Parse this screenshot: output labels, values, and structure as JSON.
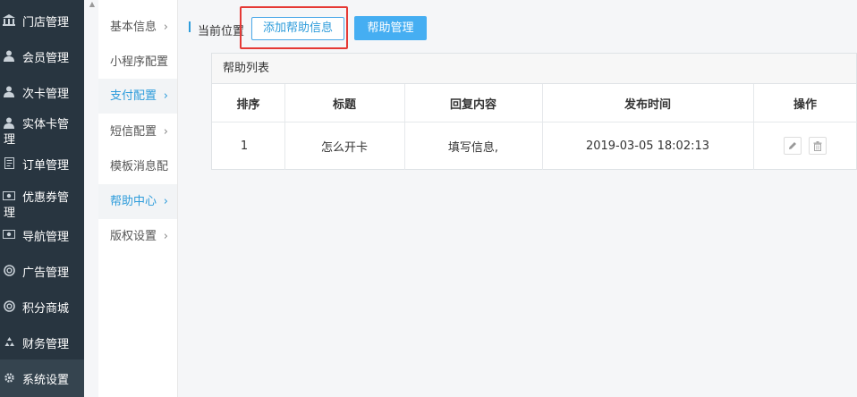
{
  "sidebar": {
    "items": [
      {
        "label": "门店管理",
        "icon": "bank-icon"
      },
      {
        "label": "会员管理",
        "icon": "user-icon"
      },
      {
        "label": "次卡管理",
        "icon": "user-icon"
      },
      {
        "label": "实体卡管",
        "label2": "理",
        "icon": "user-icon"
      },
      {
        "label": "订单管理",
        "icon": "document-icon"
      },
      {
        "label": "优惠券管",
        "label2": "理",
        "icon": "money-icon"
      },
      {
        "label": "导航管理",
        "icon": "money-icon"
      },
      {
        "label": "广告管理",
        "icon": "lifebuoy-icon"
      },
      {
        "label": "积分商城",
        "icon": "lifebuoy-icon"
      },
      {
        "label": "财务管理",
        "icon": "recycle-icon"
      },
      {
        "label": "系统设置",
        "icon": "gear-icon"
      }
    ]
  },
  "submenu": {
    "items": [
      {
        "label": "基本信息"
      },
      {
        "label": "小程序配置"
      },
      {
        "label": "支付配置"
      },
      {
        "label": "短信配置"
      },
      {
        "label": "模板消息配"
      },
      {
        "label": "帮助中心"
      },
      {
        "label": "版权设置"
      }
    ]
  },
  "header": {
    "breadcrumb": "当前位置",
    "add_button": "添加帮助信息",
    "manage_button": "帮助管理"
  },
  "panel": {
    "title": "帮助列表",
    "columns": [
      "排序",
      "标题",
      "回复内容",
      "发布时间",
      "操作"
    ],
    "rows": [
      {
        "order": "1",
        "title": "怎么开卡",
        "reply": "填写信息,",
        "time": "2019-03-05 18:02:13"
      }
    ]
  },
  "colors": {
    "sidebar_bg": "#283540",
    "accent": "#2e9cdb",
    "primary_button": "#45aef2",
    "highlight_box": "#e53935"
  }
}
